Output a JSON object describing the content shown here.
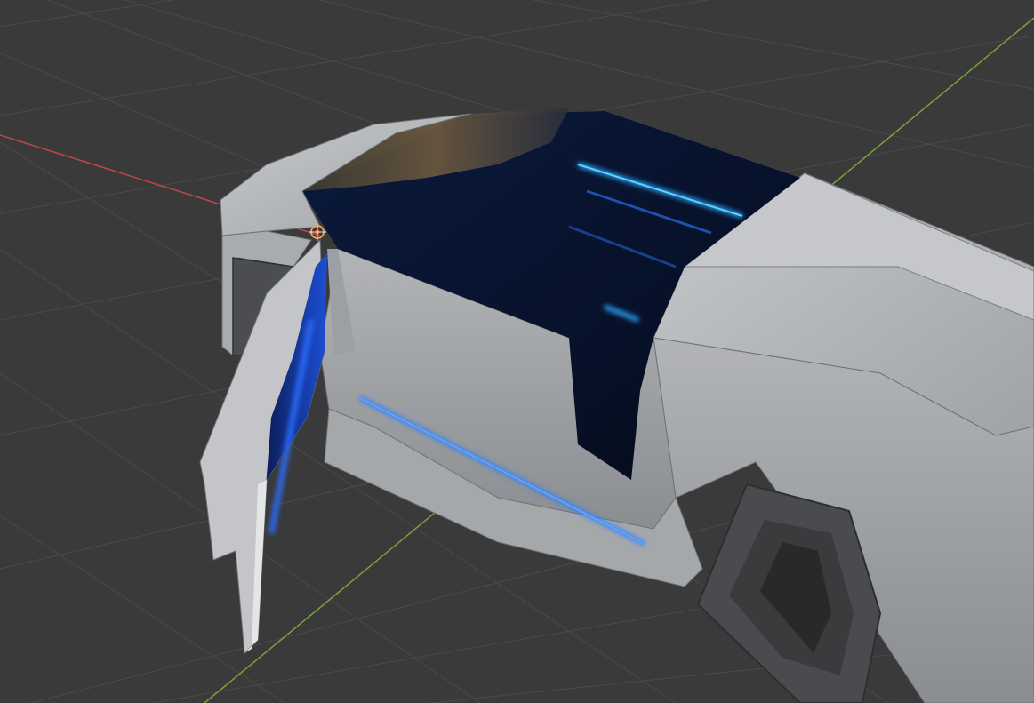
{
  "viewport": {
    "label": "3D viewport",
    "background_color": "#3a3a3a",
    "grid_color": "#4a4a4a",
    "x_axis_color": "#c0474c",
    "y_axis_color": "#7ca03a",
    "show_grid": true,
    "shading": "rendered"
  },
  "scene": {
    "object": "vehicle-model",
    "body_color": "#b4b6b9",
    "accent_light_color": "#1e7cff",
    "cabin_color": "#0a1230",
    "door_state": "open",
    "origin_marker": "3d-cursor"
  }
}
